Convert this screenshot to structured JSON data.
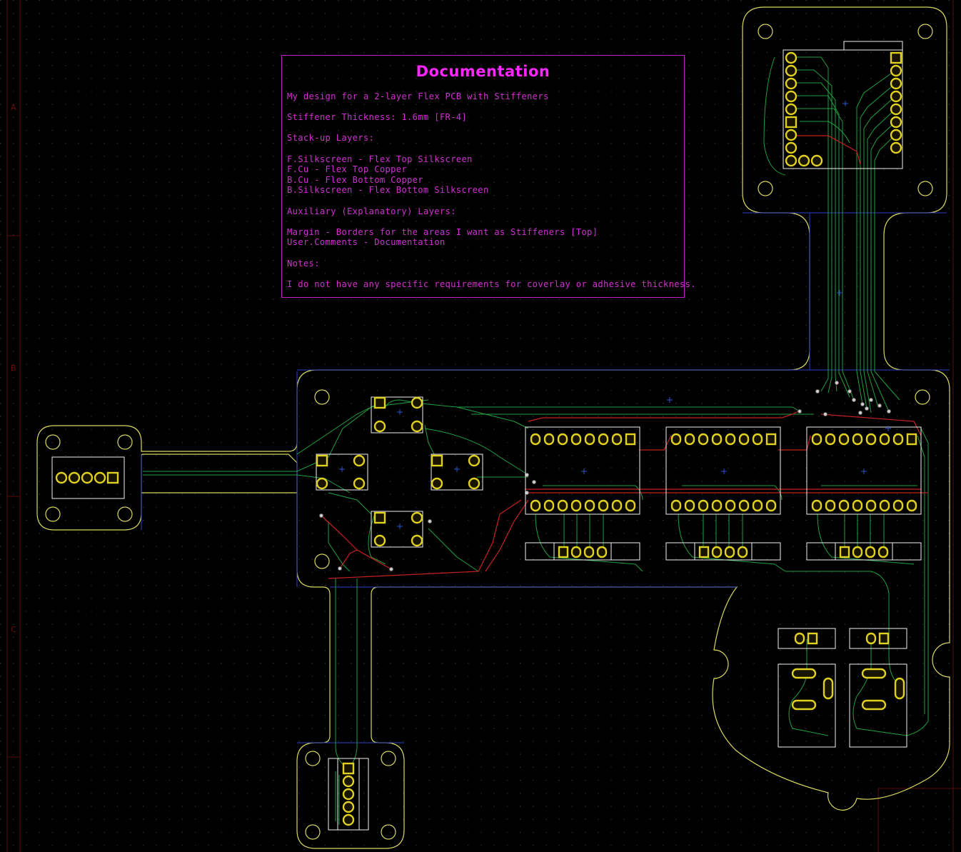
{
  "documentation": {
    "title": "Documentation",
    "lines": [
      "My design for a 2-layer Flex PCB with Stiffeners",
      "",
      "Stiffener Thickness: 1.6mm [FR-4]",
      "",
      "Stack-up Layers:",
      "",
      "F.Silkscreen - Flex Top Silkscreen",
      "F.Cu - Flex Top Copper",
      "B.Cu - Flex Bottom Copper",
      "B.Silkscreen - Flex Bottom Silkscreen",
      "",
      "Auxiliary (Explanatory) Layers:",
      "",
      "Margin - Borders for the areas I want as Stiffeners [Top]",
      "User.Comments - Documentation",
      "",
      "Notes:",
      "",
      "I do not have any specific requirements for coverlay or adhesive thickness."
    ]
  },
  "frame_letters": [
    "A",
    "B",
    "C"
  ],
  "colors": {
    "background": "#000000",
    "outline": "#d8d860",
    "pad": "#e0d020",
    "silkscreen": "#f2f2f2",
    "front_copper": "#c82020",
    "back_copper": "#20a040",
    "documentation": "#ff26ff",
    "ratsnest": "#3050d0",
    "grid": "#3a3a3a"
  }
}
